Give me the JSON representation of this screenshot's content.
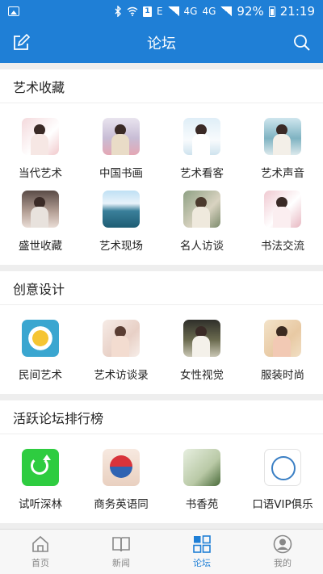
{
  "status": {
    "left_icon": "gallery-icon",
    "network_labels": [
      "E",
      "4G",
      "4G"
    ],
    "sim_label": "1",
    "battery": "92%",
    "time": "21:19"
  },
  "appbar": {
    "title": "论坛",
    "left_icon": "edit-icon",
    "right_icon": "search-icon"
  },
  "sections": [
    {
      "title": "艺术收藏",
      "items": [
        "当代艺术",
        "中国书画",
        "艺术看客",
        "艺术声音",
        "盛世收藏",
        "艺术现场",
        "名人访谈",
        "书法交流"
      ]
    },
    {
      "title": "创意设计",
      "items": [
        "民间艺术",
        "艺术访谈录",
        "女性视觉",
        "服装时尚"
      ]
    },
    {
      "title": "活跃论坛排行榜",
      "items": [
        "试听深林",
        "商务英语同",
        "书香苑",
        "口语VIP俱乐"
      ]
    }
  ],
  "tabs": [
    {
      "label": "首页",
      "icon": "home-icon"
    },
    {
      "label": "新闻",
      "icon": "book-icon"
    },
    {
      "label": "论坛",
      "icon": "grid-icon",
      "active": true
    },
    {
      "label": "我的",
      "icon": "user-icon"
    }
  ],
  "colors": {
    "brand": "#1f7fd6",
    "background": "#eeeeee"
  }
}
